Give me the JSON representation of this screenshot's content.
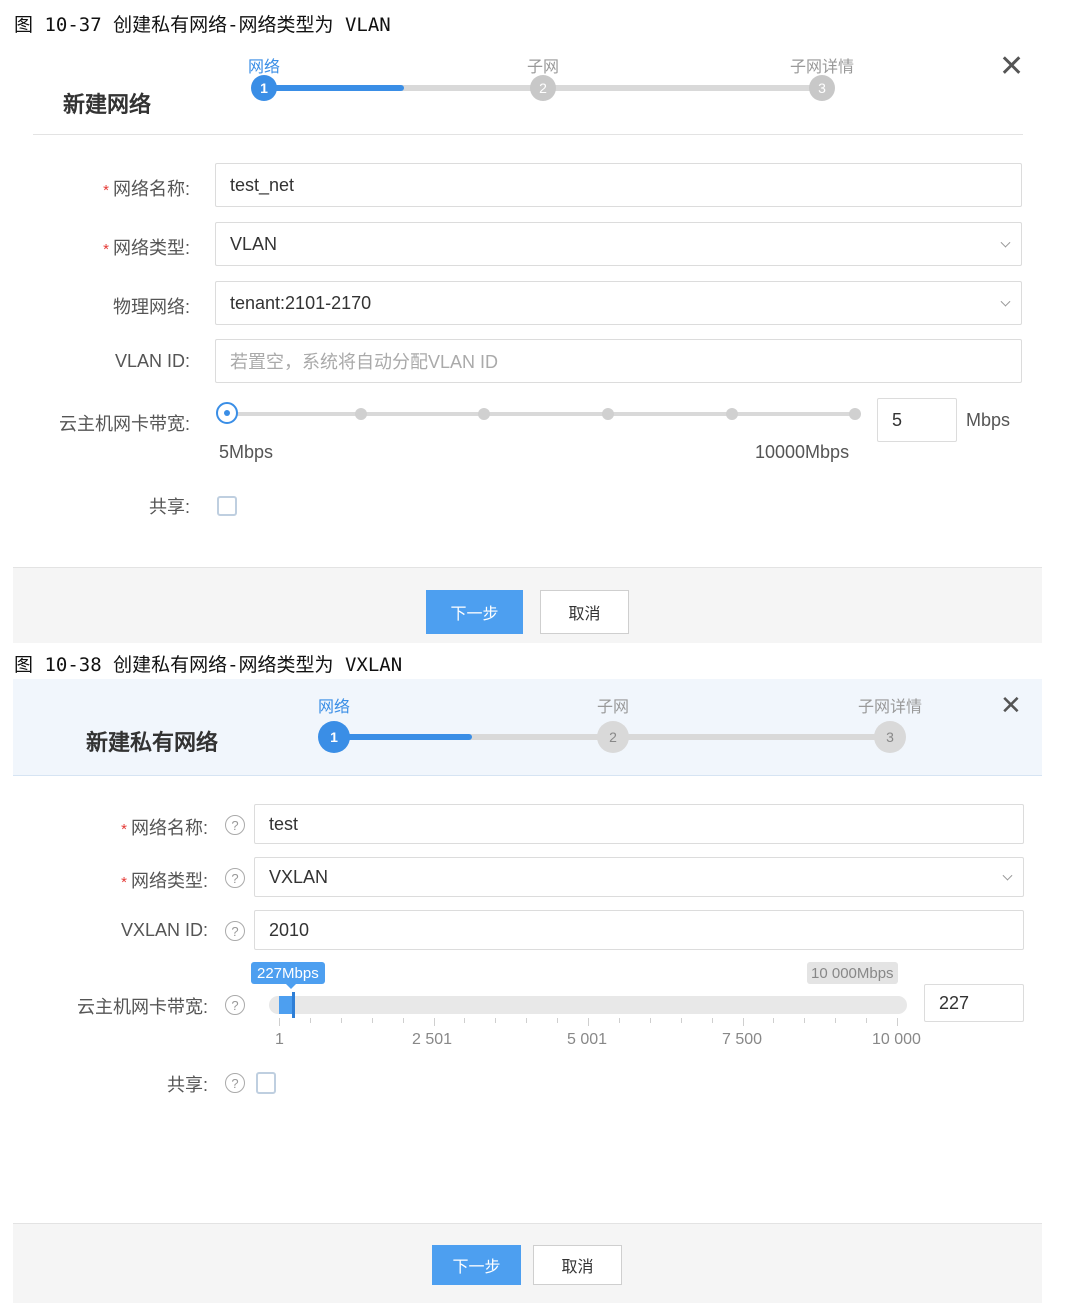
{
  "fig1": {
    "caption": "图 10-37 创建私有网络-网络类型为 VLAN",
    "dialog_title": "新建网络",
    "steps": [
      {
        "label": "网络",
        "number": "1",
        "active": true
      },
      {
        "label": "子网",
        "number": "2",
        "active": false
      },
      {
        "label": "子网详情",
        "number": "3",
        "active": false
      }
    ],
    "close_icon": "✕",
    "fields": {
      "name": {
        "label": "网络名称:",
        "required": true,
        "value": "test_net"
      },
      "type": {
        "label": "网络类型:",
        "required": true,
        "value": "VLAN"
      },
      "physical": {
        "label": "物理网络:",
        "value": "tenant:2101-2170"
      },
      "vlan_id": {
        "label": "VLAN ID:",
        "placeholder": "若置空，系统将自动分配VLAN ID"
      },
      "bandwidth": {
        "label": "云主机网卡带宽:",
        "value": "5",
        "unit": "Mbps",
        "min_label": "5Mbps",
        "max_label": "10000Mbps",
        "level": 0
      },
      "share": {
        "label": "共享:",
        "checked": false
      }
    },
    "buttons": {
      "next": "下一步",
      "cancel": "取消"
    }
  },
  "fig2": {
    "caption": "图 10-38 创建私有网络-网络类型为 VXLAN",
    "dialog_title": "新建私有网络",
    "steps": [
      {
        "label": "网络",
        "number": "1",
        "active": true
      },
      {
        "label": "子网",
        "number": "2",
        "active": false
      },
      {
        "label": "子网详情",
        "number": "3",
        "active": false
      }
    ],
    "close_icon": "✕",
    "help_icon": "?",
    "fields": {
      "name": {
        "label": "网络名称:",
        "required": true,
        "value": "test"
      },
      "type": {
        "label": "网络类型:",
        "required": true,
        "value": "VXLAN"
      },
      "vxlan_id": {
        "label": "VXLAN ID:",
        "value": "2010"
      },
      "bandwidth": {
        "label": "云主机网卡带宽:",
        "value": "227",
        "tooltip": "227Mbps",
        "max_tip": "10 000Mbps",
        "ticks": [
          "1",
          "2 501",
          "5 001",
          "7 500",
          "10 000"
        ],
        "level": 0.0226
      },
      "share": {
        "label": "共享:",
        "checked": false
      }
    },
    "buttons": {
      "next": "下一步",
      "cancel": "取消"
    }
  },
  "colors": {
    "accent": "#3a8ee6",
    "button_primary": "#4d9ff0",
    "required": "#e53935",
    "header_bg_fig2": "#f1f6fc"
  }
}
